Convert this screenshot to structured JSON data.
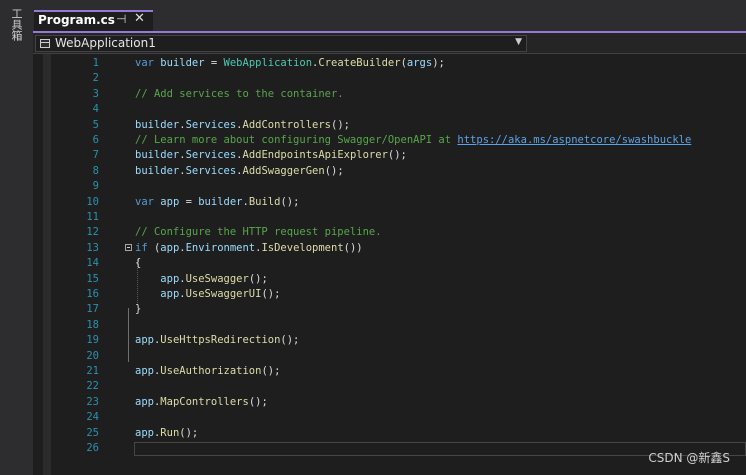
{
  "toolbox": {
    "label": "工具箱"
  },
  "tab": {
    "title": "Program.cs",
    "pin_glyph": "⊣",
    "close_glyph": "✕"
  },
  "navbar": {
    "project": "WebApplication1",
    "dropdown_glyph": "▼"
  },
  "editor": {
    "lines": [
      {
        "n": "1",
        "tokens": [
          {
            "t": "var ",
            "c": "kw"
          },
          {
            "t": "builder",
            "c": "va"
          },
          {
            "t": " = ",
            "c": "pl"
          },
          {
            "t": "WebApplication",
            "c": "ty"
          },
          {
            "t": ".",
            "c": "pl"
          },
          {
            "t": "CreateBuilder",
            "c": "me"
          },
          {
            "t": "(",
            "c": "pl"
          },
          {
            "t": "args",
            "c": "va"
          },
          {
            "t": ");",
            "c": "pl"
          }
        ]
      },
      {
        "n": "2",
        "tokens": []
      },
      {
        "n": "3",
        "tokens": [
          {
            "t": "// Add services to the container.",
            "c": "cm"
          }
        ]
      },
      {
        "n": "4",
        "tokens": []
      },
      {
        "n": "5",
        "tokens": [
          {
            "t": "builder",
            "c": "va"
          },
          {
            "t": ".",
            "c": "pl"
          },
          {
            "t": "Services",
            "c": "va"
          },
          {
            "t": ".",
            "c": "pl"
          },
          {
            "t": "AddControllers",
            "c": "me"
          },
          {
            "t": "();",
            "c": "pl"
          }
        ]
      },
      {
        "n": "6",
        "tokens": [
          {
            "t": "// Learn more about configuring Swagger/OpenAPI at ",
            "c": "cm"
          },
          {
            "t": "https://aka.ms/aspnetcore/swashbuckle",
            "c": "ur"
          }
        ]
      },
      {
        "n": "7",
        "tokens": [
          {
            "t": "builder",
            "c": "va"
          },
          {
            "t": ".",
            "c": "pl"
          },
          {
            "t": "Services",
            "c": "va"
          },
          {
            "t": ".",
            "c": "pl"
          },
          {
            "t": "AddEndpointsApiExplorer",
            "c": "me"
          },
          {
            "t": "();",
            "c": "pl"
          }
        ]
      },
      {
        "n": "8",
        "tokens": [
          {
            "t": "builder",
            "c": "va"
          },
          {
            "t": ".",
            "c": "pl"
          },
          {
            "t": "Services",
            "c": "va"
          },
          {
            "t": ".",
            "c": "pl"
          },
          {
            "t": "AddSwaggerGen",
            "c": "me"
          },
          {
            "t": "();",
            "c": "pl"
          }
        ]
      },
      {
        "n": "9",
        "tokens": []
      },
      {
        "n": "10",
        "tokens": [
          {
            "t": "var ",
            "c": "kw"
          },
          {
            "t": "app",
            "c": "va"
          },
          {
            "t": " = ",
            "c": "pl"
          },
          {
            "t": "builder",
            "c": "va"
          },
          {
            "t": ".",
            "c": "pl"
          },
          {
            "t": "Build",
            "c": "me"
          },
          {
            "t": "();",
            "c": "pl"
          }
        ]
      },
      {
        "n": "11",
        "tokens": []
      },
      {
        "n": "12",
        "tokens": [
          {
            "t": "// Configure the HTTP request pipeline.",
            "c": "cm"
          }
        ]
      },
      {
        "n": "13",
        "tokens": [
          {
            "t": "if ",
            "c": "kw"
          },
          {
            "t": "(",
            "c": "pl"
          },
          {
            "t": "app",
            "c": "va"
          },
          {
            "t": ".",
            "c": "pl"
          },
          {
            "t": "Environment",
            "c": "va"
          },
          {
            "t": ".",
            "c": "pl"
          },
          {
            "t": "IsDevelopment",
            "c": "me"
          },
          {
            "t": "())",
            "c": "pl"
          }
        ]
      },
      {
        "n": "14",
        "tokens": [
          {
            "t": "{",
            "c": "pl"
          }
        ]
      },
      {
        "n": "15",
        "tokens": [
          {
            "t": "    ",
            "c": "pl"
          },
          {
            "t": "app",
            "c": "va"
          },
          {
            "t": ".",
            "c": "pl"
          },
          {
            "t": "UseSwagger",
            "c": "me"
          },
          {
            "t": "();",
            "c": "pl"
          }
        ]
      },
      {
        "n": "16",
        "tokens": [
          {
            "t": "    ",
            "c": "pl"
          },
          {
            "t": "app",
            "c": "va"
          },
          {
            "t": ".",
            "c": "pl"
          },
          {
            "t": "UseSwaggerUI",
            "c": "me"
          },
          {
            "t": "();",
            "c": "pl"
          }
        ]
      },
      {
        "n": "17",
        "tokens": [
          {
            "t": "}",
            "c": "pl"
          }
        ]
      },
      {
        "n": "18",
        "tokens": []
      },
      {
        "n": "19",
        "tokens": [
          {
            "t": "app",
            "c": "va"
          },
          {
            "t": ".",
            "c": "pl"
          },
          {
            "t": "UseHttpsRedirection",
            "c": "me"
          },
          {
            "t": "();",
            "c": "pl"
          }
        ]
      },
      {
        "n": "20",
        "tokens": []
      },
      {
        "n": "21",
        "tokens": [
          {
            "t": "app",
            "c": "va"
          },
          {
            "t": ".",
            "c": "pl"
          },
          {
            "t": "UseAuthorization",
            "c": "me"
          },
          {
            "t": "();",
            "c": "pl"
          }
        ]
      },
      {
        "n": "22",
        "tokens": []
      },
      {
        "n": "23",
        "tokens": [
          {
            "t": "app",
            "c": "va"
          },
          {
            "t": ".",
            "c": "pl"
          },
          {
            "t": "MapControllers",
            "c": "me"
          },
          {
            "t": "();",
            "c": "pl"
          }
        ]
      },
      {
        "n": "24",
        "tokens": []
      },
      {
        "n": "25",
        "tokens": [
          {
            "t": "app",
            "c": "va"
          },
          {
            "t": ".",
            "c": "pl"
          },
          {
            "t": "Run",
            "c": "me"
          },
          {
            "t": "();",
            "c": "pl"
          }
        ]
      },
      {
        "n": "26",
        "tokens": []
      }
    ]
  },
  "watermark": "CSDN @新鑫S",
  "colors": {
    "background": "#1e1e1e",
    "accent": "#9479d6",
    "keyword": "#569cd6",
    "type": "#4ec9b0",
    "method": "#dcdcaa",
    "variable": "#9cdcfe",
    "comment": "#57a64a",
    "line_number": "#2b91af"
  }
}
